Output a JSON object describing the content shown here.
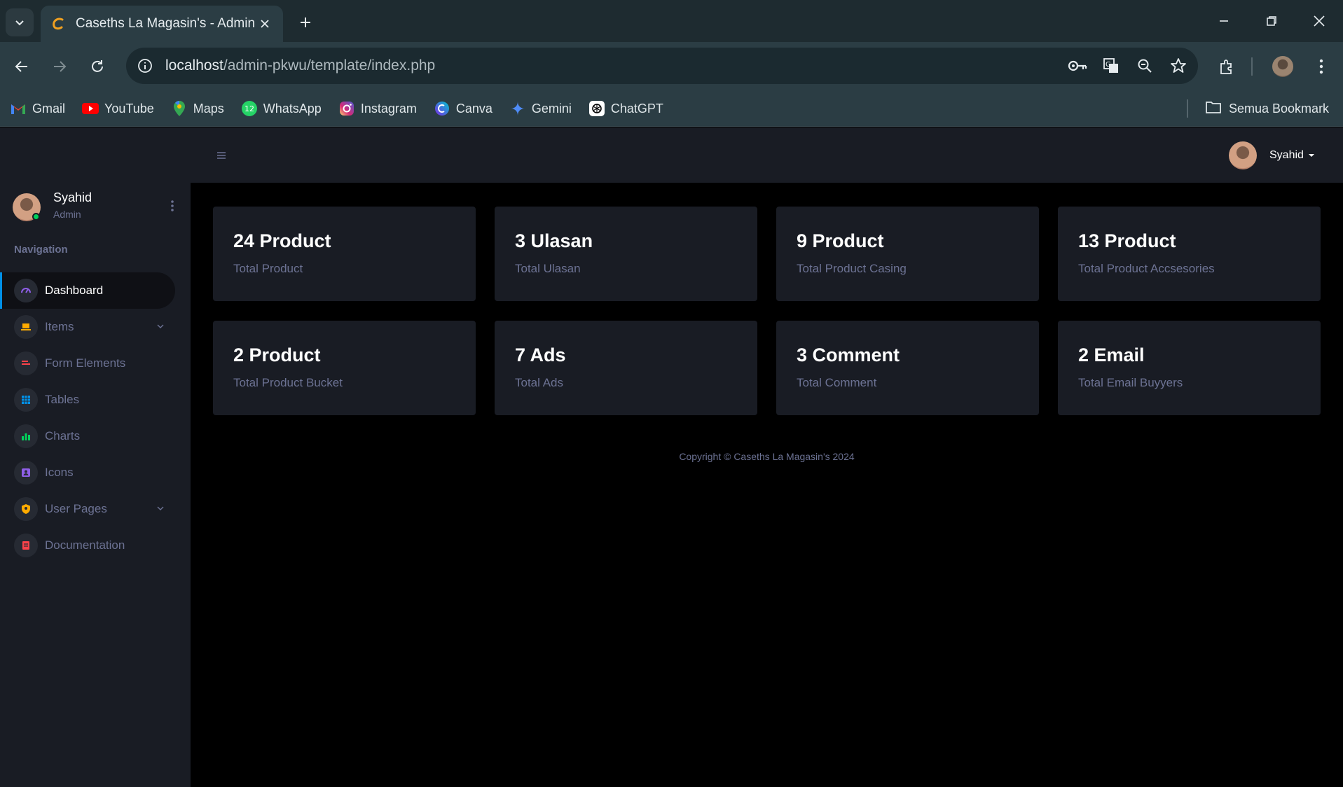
{
  "browser": {
    "tab_title": "Caseths La Magasin's - Admin",
    "url_host": "localhost",
    "url_path": "/admin-pkwu/template/index.php",
    "bookmarks": [
      {
        "label": "Gmail",
        "icon": "gmail-icon"
      },
      {
        "label": "YouTube",
        "icon": "youtube-icon"
      },
      {
        "label": "Maps",
        "icon": "maps-icon"
      },
      {
        "label": "WhatsApp",
        "icon": "whatsapp-icon"
      },
      {
        "label": "Instagram",
        "icon": "instagram-icon"
      },
      {
        "label": "Canva",
        "icon": "canva-icon"
      },
      {
        "label": "Gemini",
        "icon": "gemini-icon"
      },
      {
        "label": "ChatGPT",
        "icon": "chatgpt-icon"
      }
    ],
    "whatsapp_badge": "12",
    "all_bookmarks": "Semua Bookmark"
  },
  "sidebar": {
    "profile_name": "Syahid",
    "profile_role": "Admin",
    "nav_heading": "Navigation",
    "items": [
      {
        "label": "Dashboard",
        "icon": "speedometer-icon",
        "color": "#8f5fe8",
        "active": true
      },
      {
        "label": "Items",
        "icon": "laptop-icon",
        "color": "#ffab00",
        "has_children": true
      },
      {
        "label": "Form Elements",
        "icon": "playlist-icon",
        "color": "#fc424a"
      },
      {
        "label": "Tables",
        "icon": "table-icon",
        "color": "#0090e7"
      },
      {
        "label": "Charts",
        "icon": "chart-bar-icon",
        "color": "#00d25b"
      },
      {
        "label": "Icons",
        "icon": "contacts-icon",
        "color": "#8f5fe8"
      },
      {
        "label": "User Pages",
        "icon": "security-icon",
        "color": "#ffab00",
        "has_children": true
      },
      {
        "label": "Documentation",
        "icon": "file-document-icon",
        "color": "#fc424a"
      }
    ]
  },
  "topbar": {
    "user_name": "Syahid"
  },
  "stats": [
    {
      "value": "24 Product",
      "label": "Total Product"
    },
    {
      "value": "3 Ulasan",
      "label": "Total Ulasan"
    },
    {
      "value": "9 Product",
      "label": "Total Product Casing"
    },
    {
      "value": "13 Product",
      "label": "Total Product Accsesories"
    },
    {
      "value": "2 Product",
      "label": "Total Product Bucket"
    },
    {
      "value": "7 Ads",
      "label": "Total Ads"
    },
    {
      "value": "3 Comment",
      "label": "Total Comment"
    },
    {
      "value": "2 Email",
      "label": "Total Email Buyyers"
    }
  ],
  "footer": {
    "copyright": "Copyright © Caseths La Magasin's 2024"
  },
  "colors": {
    "sidebar_bg": "#191c24",
    "content_bg": "#000000",
    "card_bg": "#191c24",
    "muted_text": "#6c7293",
    "accent_blue": "#0090e7",
    "online_green": "#00d25b"
  }
}
